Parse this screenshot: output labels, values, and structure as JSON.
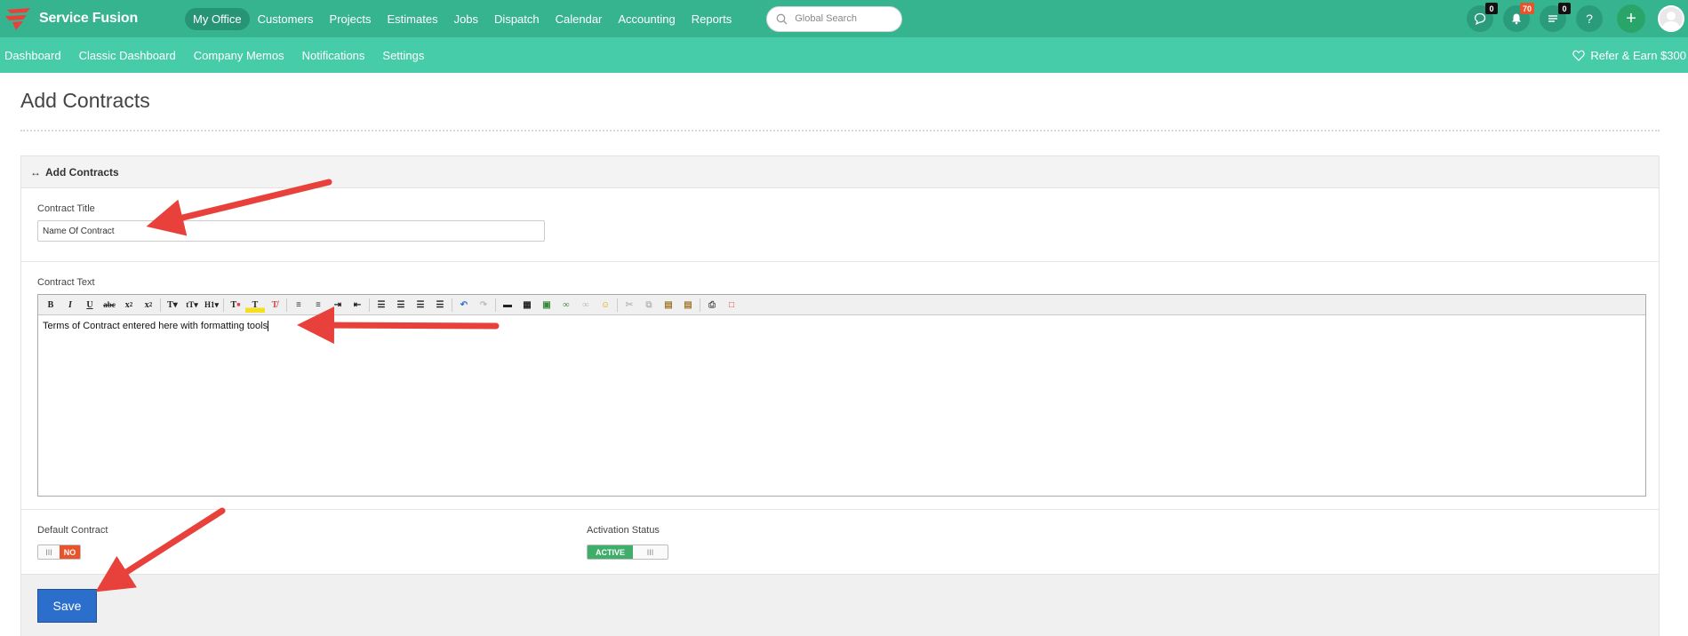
{
  "brand": {
    "name": "Service Fusion",
    "color": "#36b48f"
  },
  "main_nav": [
    {
      "label": "My Office",
      "active": true
    },
    {
      "label": "Customers"
    },
    {
      "label": "Projects"
    },
    {
      "label": "Estimates"
    },
    {
      "label": "Jobs"
    },
    {
      "label": "Dispatch"
    },
    {
      "label": "Calendar"
    },
    {
      "label": "Accounting"
    },
    {
      "label": "Reports"
    }
  ],
  "search": {
    "placeholder": "Global Search"
  },
  "header_icons": {
    "chat_count": "0",
    "notification_count": "70",
    "tasks_count": "0",
    "help": "?",
    "add": "+"
  },
  "sub_nav": [
    "Dashboard",
    "Classic Dashboard",
    "Company Memos",
    "Notifications",
    "Settings"
  ],
  "refer": "Refer & Earn $300",
  "page": {
    "title": "Add Contracts",
    "panel_title": "Add Contracts"
  },
  "form": {
    "contract_title_label": "Contract Title",
    "contract_title_value": "Name Of Contract",
    "contract_text_label": "Contract Text",
    "contract_text_value": "Terms of Contract entered here with formatting tools",
    "default_contract_label": "Default Contract",
    "default_contract_state": "NO",
    "activation_status_label": "Activation Status",
    "activation_status_state": "ACTIVE",
    "toggle_handle": "III",
    "save_label": "Save"
  },
  "annotation_color": "#e8413c"
}
